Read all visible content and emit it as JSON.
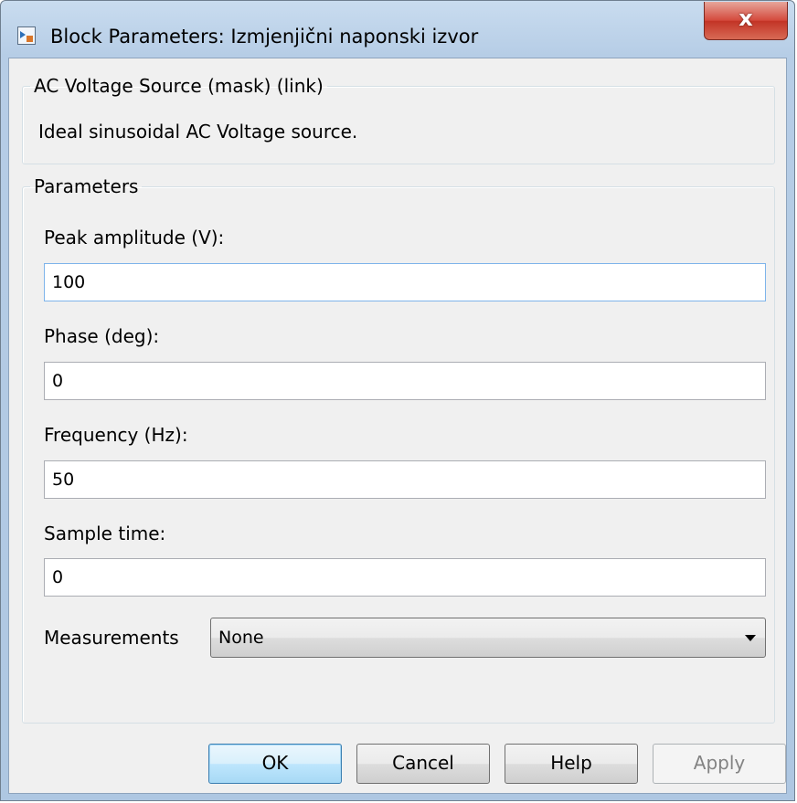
{
  "window": {
    "title": "Block Parameters: Izmjenjični naponski izvor",
    "close_label": "x"
  },
  "description_group": {
    "legend": "AC Voltage Source (mask) (link)",
    "text": "Ideal sinusoidal AC Voltage source."
  },
  "parameters": {
    "legend": "Parameters",
    "peak_amplitude": {
      "label": "Peak amplitude (V):",
      "value": "100"
    },
    "phase": {
      "label": "Phase (deg):",
      "value": "0"
    },
    "frequency": {
      "label": "Frequency (Hz):",
      "value": "50"
    },
    "sample_time": {
      "label": "Sample time:",
      "value": "0"
    },
    "measurements": {
      "label": "Measurements",
      "selected": "None"
    }
  },
  "buttons": {
    "ok": "OK",
    "cancel": "Cancel",
    "help": "Help",
    "apply": "Apply"
  }
}
